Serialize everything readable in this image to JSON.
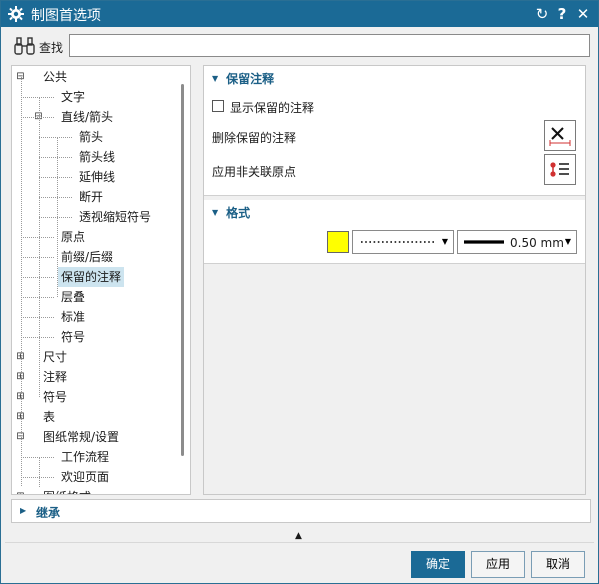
{
  "window": {
    "title": "制图首选项",
    "controls": [
      "reset-icon",
      "help-icon",
      "close-icon"
    ],
    "help_label": "?",
    "close_label": "✕",
    "reset_label": "↻"
  },
  "search": {
    "label": "查找",
    "value": "",
    "placeholder": ""
  },
  "tree": {
    "items": [
      {
        "label": "公共",
        "level": 0,
        "toggle": "⊟"
      },
      {
        "label": "文字",
        "level": 1
      },
      {
        "label": "直线/箭头",
        "level": 1,
        "toggle": "⊟"
      },
      {
        "label": "箭头",
        "level": 2
      },
      {
        "label": "箭头线",
        "level": 2
      },
      {
        "label": "延伸线",
        "level": 2
      },
      {
        "label": "断开",
        "level": 2
      },
      {
        "label": "透视缩短符号",
        "level": 2
      },
      {
        "label": "原点",
        "level": 1
      },
      {
        "label": "前缀/后缀",
        "level": 1
      },
      {
        "label": "保留的注释",
        "level": 1,
        "selected": true
      },
      {
        "label": "层叠",
        "level": 1
      },
      {
        "label": "标准",
        "level": 1
      },
      {
        "label": "符号",
        "level": 1
      },
      {
        "label": "尺寸",
        "level": 0,
        "toggle": "⊞"
      },
      {
        "label": "注释",
        "level": 0,
        "toggle": "⊞"
      },
      {
        "label": "符号",
        "level": 0,
        "toggle": "⊞"
      },
      {
        "label": "表",
        "level": 0,
        "toggle": "⊞"
      },
      {
        "label": "图纸常规/设置",
        "level": 0,
        "toggle": "⊟"
      },
      {
        "label": "工作流程",
        "level": 1
      },
      {
        "label": "欢迎页面",
        "level": 1
      },
      {
        "label": "图纸格式",
        "level": 0,
        "toggle": "⊞"
      }
    ]
  },
  "retained": {
    "title": "保留注释",
    "show_checkbox": {
      "label": "显示保留的注释",
      "checked": false
    },
    "delete_label": "删除保留的注释",
    "apply_label": "应用非关联原点",
    "delete_icon": "delete-retained-icon",
    "apply_icon": "origin-list-icon"
  },
  "format": {
    "title": "格式",
    "color": "#ffff00",
    "line_style": "dotted",
    "line_width": "0.50 mm"
  },
  "inherit": {
    "label": "继承"
  },
  "buttons": {
    "ok": "确定",
    "apply": "应用",
    "cancel": "取消"
  },
  "colors": {
    "title_bar": "#1b6a96",
    "accent": "#1b5f86",
    "selection": "#cde4ef"
  }
}
